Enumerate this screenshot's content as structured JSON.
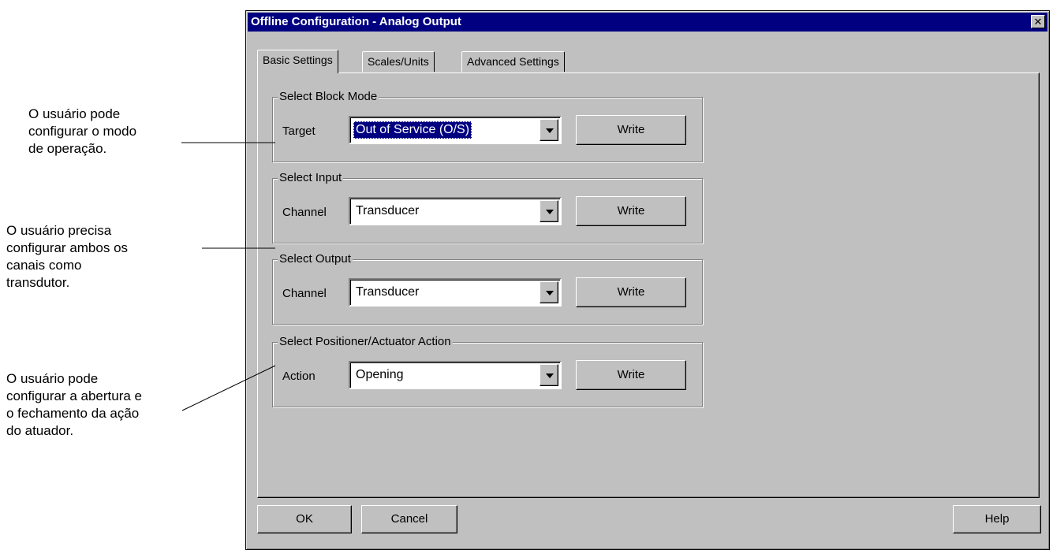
{
  "annotations": [
    {
      "text": "O usuário pode\nconfigurar o modo\nde operação."
    },
    {
      "text": "O usuário precisa\nconfigurar ambos os\ncanais como\ntransdutor."
    },
    {
      "text": "O usuário pode\nconfigurar a abertura e\no fechamento da ação\ndo atuador."
    }
  ],
  "dialog": {
    "title": "Offline Configuration - Analog Output",
    "close_glyph": "✕",
    "tabs": [
      {
        "label": "Basic Settings",
        "active": true
      },
      {
        "label": "Scales/Units",
        "active": false
      },
      {
        "label": "Advanced Settings",
        "active": false
      }
    ],
    "groups": [
      {
        "title": "Select Block Mode",
        "label": "Target",
        "value": "Out of Service (O/S)",
        "selected": true,
        "button": "Write"
      },
      {
        "title": "Select Input",
        "label": "Channel",
        "value": "Transducer",
        "selected": false,
        "button": "Write"
      },
      {
        "title": "Select Output",
        "label": "Channel",
        "value": "Transducer",
        "selected": false,
        "button": "Write"
      },
      {
        "title": "Select Positioner/Actuator Action",
        "label": "Action",
        "value": "Opening",
        "selected": false,
        "button": "Write"
      }
    ],
    "buttons": {
      "ok": "OK",
      "cancel": "Cancel",
      "help": "Help"
    }
  },
  "colors": {
    "titlebar": "#000080",
    "face": "#c0c0c0",
    "selection": "#000080"
  },
  "icons": {
    "dropdown": "chevron-down-icon",
    "close": "close-icon"
  }
}
